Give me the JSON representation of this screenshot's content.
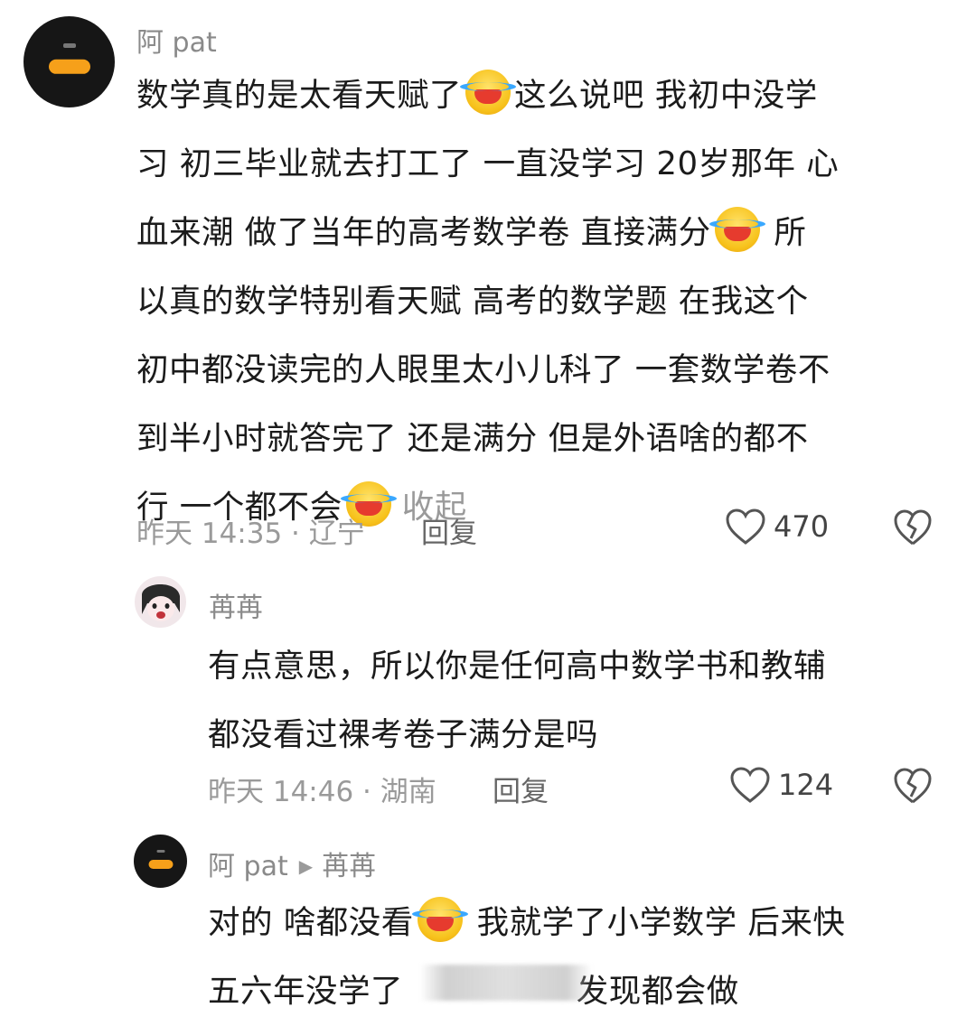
{
  "comments": [
    {
      "user": "阿 pat",
      "lines": [
        [
          "数学真的是太看天赋了",
          "[emoji]",
          "这么说吧 我初中没学"
        ],
        [
          "习 初三毕业就去打工了 一直没学习 20岁那年 心"
        ],
        [
          "血来潮 做了当年的高考数学卷 直接满分",
          "[emoji]",
          " 所"
        ],
        [
          "以真的数学特别看天赋 高考的数学题 在我这个"
        ],
        [
          "初中都没读完的人眼里太小儿科了 一套数学卷不"
        ],
        [
          "到半小时就答完了 还是满分 但是外语啥的都不"
        ],
        [
          "行 一个都不会",
          "[emoji]"
        ]
      ],
      "collapse_label": "收起",
      "time_location": "昨天 14:35 · 辽宁",
      "reply_label": "回复",
      "likes": "470"
    },
    {
      "user": "苒苒",
      "lines": [
        [
          "有点意思，所以你是任何高中数学书和教辅"
        ],
        [
          "都没看过裸考卷子满分是吗"
        ]
      ],
      "time_location": "昨天 14:46 · 湖南",
      "reply_label": "回复",
      "likes": "124"
    },
    {
      "user": "阿 pat",
      "reply_to": "苒苒",
      "lines": [
        [
          "对的 啥都没看",
          "[emoji]",
          " 我就学了小学数学 后来快"
        ],
        [
          "五六年没学了",
          "[obscured]",
          " 发现都会做"
        ]
      ]
    }
  ],
  "icons": {
    "like": "heart-outline-icon",
    "dislike": "broken-heart-icon",
    "emoji": "laugh-cry-emoji",
    "reply_arrow": "play-triangle-icon"
  },
  "colors": {
    "avatar_pill": "#f6a01a",
    "secondary_text": "#9a9a9a",
    "body_text": "#1b1b1b"
  }
}
